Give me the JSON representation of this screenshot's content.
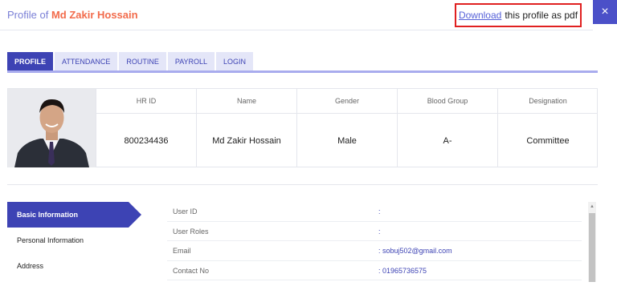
{
  "header": {
    "title_prefix": "Profile of",
    "title_name": "Md Zakir Hossain",
    "download_link": "Download",
    "download_suffix": "this profile as pdf",
    "close_label": "×"
  },
  "tabs": [
    "PROFILE",
    "ATTENDANCE",
    "ROUTINE",
    "PAYROLL",
    "LOGIN"
  ],
  "summary": {
    "headers": [
      "HR ID",
      "Name",
      "Gender",
      "Blood Group",
      "Designation"
    ],
    "values": [
      "800234436",
      "Md Zakir Hossain",
      "Male",
      "A-",
      "Committee"
    ]
  },
  "sidebar": {
    "items": [
      "Basic Information",
      "Personal Information",
      "Address"
    ]
  },
  "basic_info": {
    "rows": [
      {
        "label": "User ID",
        "value": ":"
      },
      {
        "label": "User Roles",
        "value": ":"
      },
      {
        "label": "Email",
        "value": ": sobuj502@gmail.com"
      },
      {
        "label": "Contact No",
        "value": ": 01965736575"
      }
    ]
  },
  "colors": {
    "accent": "#3d43b4",
    "title_name": "#f26b4b",
    "highlight_border": "#e02020"
  }
}
